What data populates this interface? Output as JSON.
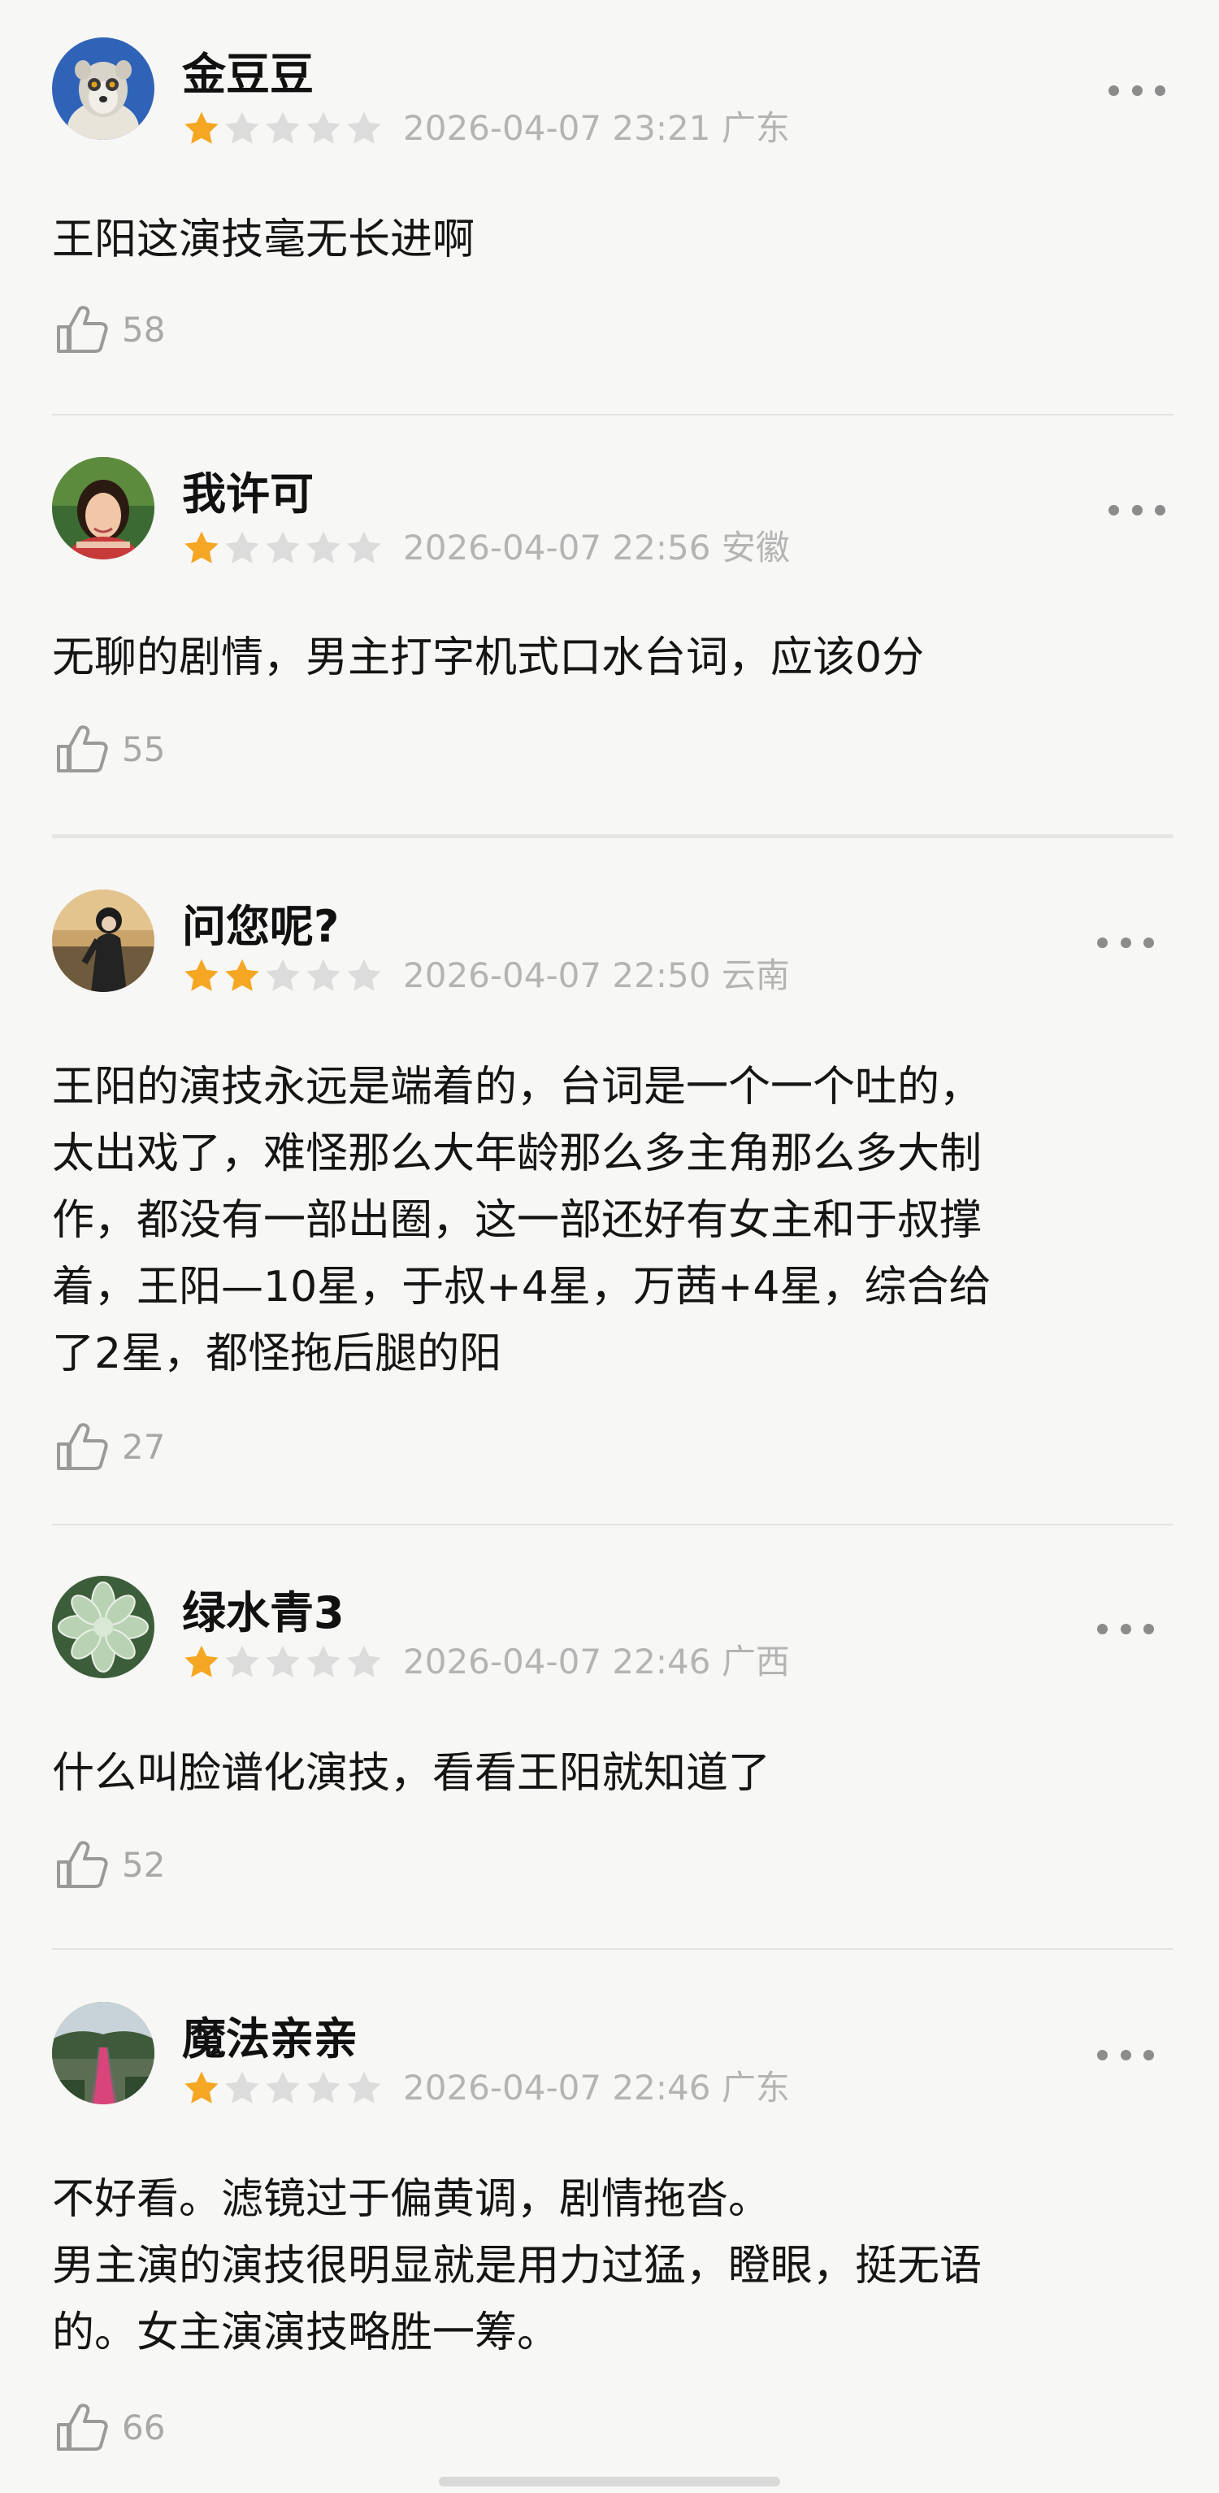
{
  "reviews": [
    {
      "username": "金豆豆",
      "rating": 1,
      "rating_max": 5,
      "datetime": "2026-04-07 23:21",
      "location": "广东",
      "text": "王阳这演技毫无长进啊",
      "likes": "58"
    },
    {
      "username": "我许可",
      "rating": 1,
      "rating_max": 5,
      "datetime": "2026-04-07 22:56",
      "location": "安徽",
      "text": "无聊的剧情，男主打字机式口水台词，应该0分",
      "likes": "55"
    },
    {
      "username": "问您呢?",
      "rating": 2,
      "rating_max": 5,
      "datetime": "2026-04-07 22:50",
      "location": "云南",
      "text": "王阳的演技永远是端着的，台词是一个一个吐的，\n太出戏了，难怪那么大年龄那么多主角那么多大制\n作，都没有一部出圈，这一部还好有女主和于叔撑\n着，王阳—10星，于叔+4星，万茜+4星，综合给\n了2星，都怪拖后腿的阳",
      "likes": "27"
    },
    {
      "username": "绿水青3",
      "rating": 1,
      "rating_max": 5,
      "datetime": "2026-04-07 22:46",
      "location": "广西",
      "text": "什么叫脸谱化演技，看看王阳就知道了",
      "likes": "52"
    },
    {
      "username": "魔法亲亲",
      "rating": 1,
      "rating_max": 5,
      "datetime": "2026-04-07 22:46",
      "location": "广东",
      "text": "不好看。滤镜过于偏黄调，剧情拖沓。\n男主演的演技很明显就是用力过猛，瞪眼，挺无语\n的。女主演演技略胜一筹。",
      "likes": "66"
    }
  ],
  "colors": {
    "star_filled": "#f5a623",
    "star_empty": "#dcdcdc",
    "meta_text": "#b4b4b4",
    "background": "#f7f7f5"
  },
  "icons": {
    "more": "more-dots-icon",
    "like": "thumbs-up-icon",
    "star": "star-icon"
  }
}
